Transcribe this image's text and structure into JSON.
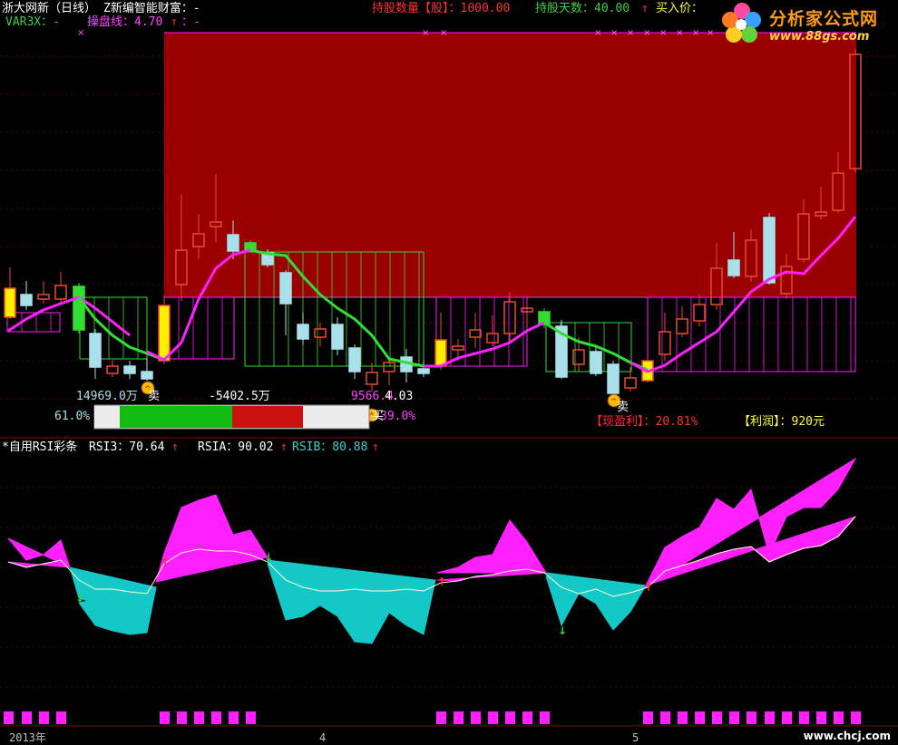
{
  "top_header": {
    "stock": "浙大网新（日线）",
    "formula": "Z新编智能财富：-",
    "holding_qty": "持股数量【股】：1000.00",
    "holding_days": "持股天数：40.00",
    "buy_price": "买入价：",
    "arrow": "↑"
  },
  "row2": {
    "var3x": "VAR3X：-",
    "operate": "操盘线：4.70",
    "tail": "：-"
  },
  "annotations": {
    "left_amount": "14969.0万",
    "mid_amount": "-5402.5万",
    "right_amount": "9566.4",
    "right_amount_tail": "4.03",
    "left_pct": "61.0%",
    "right_pct": "39.0%",
    "buy_tag": "买",
    "sell_tag": "卖",
    "profit_now": "【现盈利】：20.81%",
    "profit": "【利润】：920元"
  },
  "lower_header": {
    "title": "*自用RSI彩条",
    "rsi3": "RSI3：70.64",
    "rsia": "RSIA：90.02",
    "rsib": "RSIB：80.88",
    "arrow": "↑"
  },
  "axis": {
    "labels": [
      "2013年",
      "4",
      "5"
    ]
  },
  "logo": {
    "title": "分析家公式网",
    "url": "www.88gs.com"
  },
  "watermark": "www.chcj.com",
  "colors": {
    "background": "#000000",
    "up": "#e84a2a",
    "down": "#a8e0ec",
    "profit_zone": "#9a0000",
    "magenta": "#ff20ff",
    "green_line": "#33dd33",
    "cyan_fill": "#14c8c8",
    "yellow": "#ffee00"
  }
}
